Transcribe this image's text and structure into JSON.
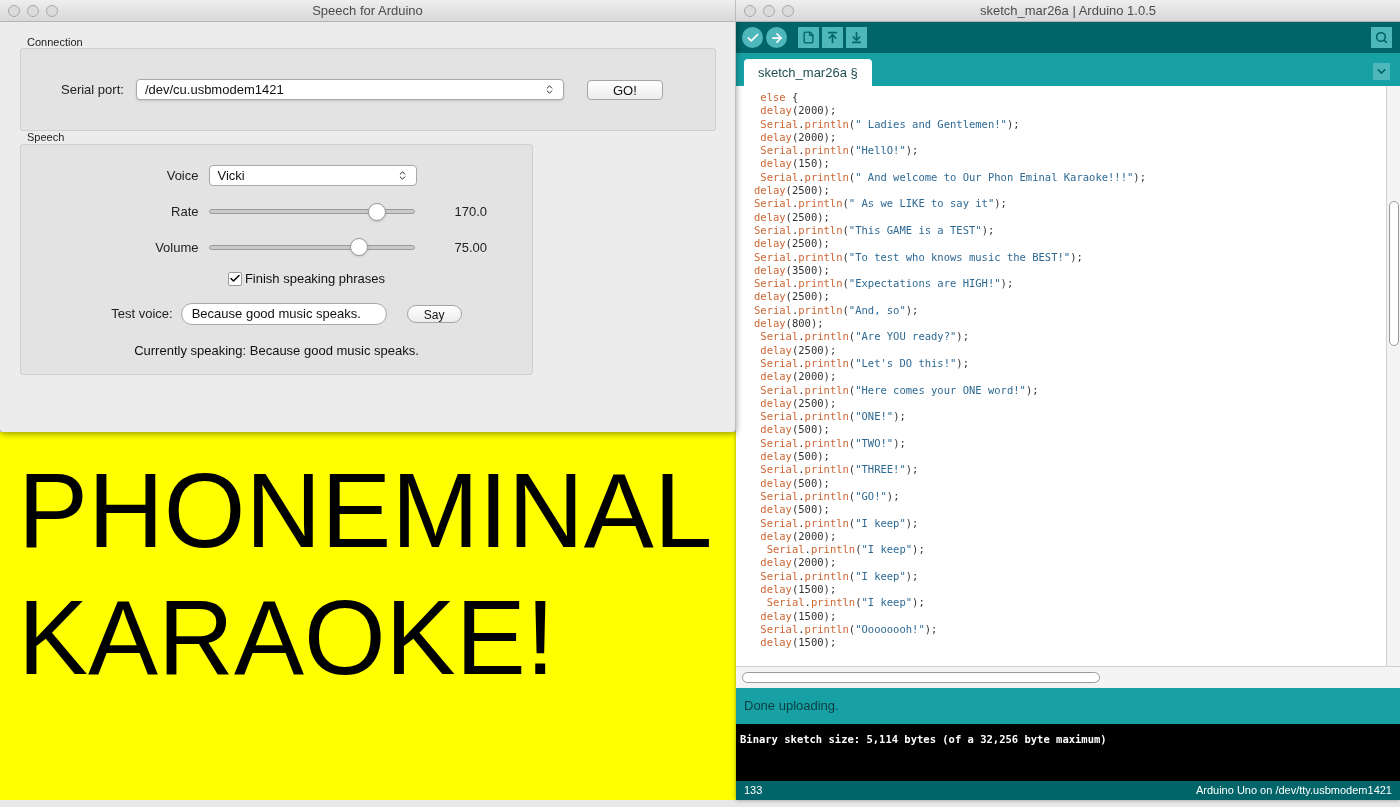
{
  "speech_window": {
    "title": "Speech for Arduino",
    "connection": {
      "label": "Connection",
      "serial_port_label": "Serial port:",
      "serial_port_value": "/dev/cu.usbmodem1421",
      "go_button": "GO!"
    },
    "speech": {
      "label": "Speech",
      "voice_label": "Voice",
      "voice_value": "Vicki",
      "sliders": [
        {
          "label": "Rate",
          "level": 0.82,
          "reading": "170.0"
        },
        {
          "label": "Volume",
          "level": 0.73,
          "reading": "75.00"
        }
      ],
      "finish_checkbox": {
        "label": "Finish speaking phrases",
        "checked": true
      },
      "test_voice_label": "Test voice:",
      "test_voice_value": "Because good music speaks.",
      "say_button": "Say",
      "status": "Currently speaking: Because good music speaks."
    }
  },
  "banner": {
    "lines": [
      "PHONEMINAL",
      "KARAOKE!"
    ]
  },
  "arduino_window": {
    "title": "sketch_mar26a | Arduino 1.0.5",
    "tabs": [
      {
        "label": "sketch_mar26a §",
        "selected": true
      }
    ],
    "code_lines": [
      " else {",
      " delay(2000);",
      " Serial.println(\" Ladies and Gentlemen!\");",
      " delay(2000);",
      " Serial.println(\"HellO!\");",
      " delay(150);",
      " Serial.println(\" And welcome to Our Phon Eminal Karaoke!!!\");",
      "delay(2500);",
      "Serial.println(\" As we LIKE to say it\");",
      "delay(2500);",
      "Serial.println(\"This GAME is a TEST\");",
      "delay(2500);",
      "Serial.println(\"To test who knows music the BEST!\");",
      "delay(3500);",
      "Serial.println(\"Expectations are HIGH!\");",
      "delay(2500);",
      "Serial.println(\"And, so\");",
      "delay(800);",
      " Serial.println(\"Are YOU ready?\");",
      " delay(2500);",
      " Serial.println(\"Let's DO this!\");",
      " delay(2000);",
      " Serial.println(\"Here comes your ONE word!\");",
      " delay(2500);",
      " Serial.println(\"ONE!\");",
      " delay(500);",
      " Serial.println(\"TWO!\");",
      " delay(500);",
      " Serial.println(\"THREE!\");",
      " delay(500);",
      " Serial.println(\"GO!\");",
      " delay(500);",
      " Serial.println(\"I keep\");",
      " delay(2000);",
      "  Serial.println(\"I keep\");",
      " delay(2000);",
      " Serial.println(\"I keep\");",
      " delay(1500);",
      "  Serial.println(\"I keep\");",
      " delay(1500);",
      " Serial.println(\"Oooooooh!\");",
      " delay(1500);"
    ],
    "status_message": "Done uploading.",
    "console": "Binary sketch size: 5,114 bytes (of a 32,256 byte maximum)",
    "line_number": "133",
    "board": "Arduino Uno on /dev/tty.usbmodem1421"
  }
}
